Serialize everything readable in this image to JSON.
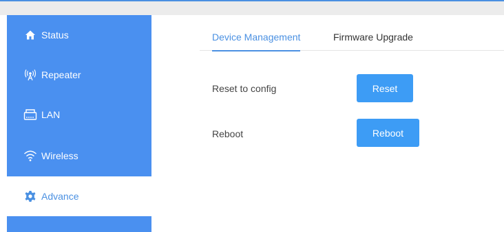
{
  "sidebar": {
    "items": [
      {
        "label": "Status",
        "icon": "home-icon"
      },
      {
        "label": "Repeater",
        "icon": "antenna-icon"
      },
      {
        "label": "LAN",
        "icon": "lan-port-icon"
      },
      {
        "label": "Wireless",
        "icon": "wifi-icon"
      },
      {
        "label": "Advance",
        "icon": "gear-icon",
        "active": true
      }
    ]
  },
  "tabs": [
    {
      "label": "Device Management",
      "active": true
    },
    {
      "label": "Firmware Upgrade",
      "active": false
    }
  ],
  "main": {
    "reset_label": "Reset to config",
    "reset_button": "Reset",
    "reboot_label": "Reboot",
    "reboot_button": "Reboot"
  },
  "colors": {
    "accent": "#4a90e2",
    "sidebar": "#4a90f0",
    "button": "#3d9cf5"
  }
}
